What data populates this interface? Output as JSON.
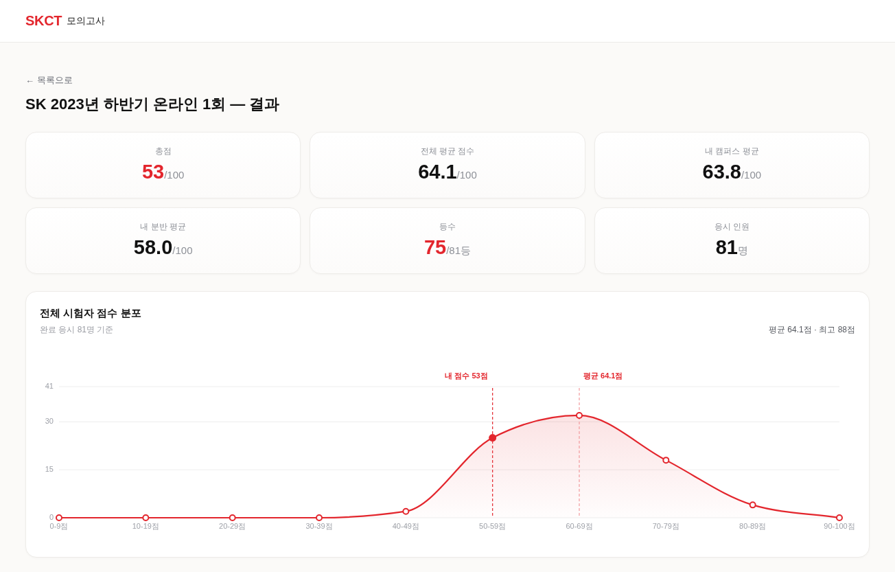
{
  "header": {
    "logo": "SKCT",
    "title": "모의고사"
  },
  "back_link": "← 목록으로",
  "page_title": "SK 2023년 하반기 온라인 1회 — 결과",
  "stats": [
    {
      "label": "총점",
      "value": "53",
      "unit": "/100",
      "highlight": true
    },
    {
      "label": "전체 평균 점수",
      "value": "64.1",
      "unit": "/100",
      "highlight": false
    },
    {
      "label": "내 캠퍼스 평균",
      "value": "63.8",
      "unit": "/100",
      "highlight": false
    },
    {
      "label": "내 분반 평균",
      "value": "58.0",
      "unit": "/100",
      "highlight": false
    },
    {
      "label": "등수",
      "value": "75",
      "unit": "/81등",
      "highlight": true
    },
    {
      "label": "응시 인원",
      "value": "81",
      "unit": "명",
      "highlight": false
    }
  ],
  "distribution": {
    "title": "전체 시험자 점수 분포",
    "subtitle": "완료 응시 81명 기준",
    "summary": "평균 64.1점 · 최고 88점",
    "chart_data": {
      "type": "area",
      "categories": [
        "0-9점",
        "10-19점",
        "20-29점",
        "30-39점",
        "40-49점",
        "50-59점",
        "60-69점",
        "70-79점",
        "80-89점",
        "90-100점"
      ],
      "series": [
        {
          "color": "#e3262d",
          "values": [
            0,
            0,
            0,
            0,
            2,
            25,
            32,
            18,
            4,
            0
          ]
        }
      ],
      "ylim": [
        0,
        41
      ],
      "yticks": [
        0,
        15,
        30,
        41
      ],
      "ref_lines": [
        {
          "axis": "x",
          "value": "50-59점",
          "label": "내 점수 53점",
          "color": "#e3262d"
        },
        {
          "axis": "x",
          "value": "60-69점",
          "label": "평균 64.1점",
          "color": "#f29a9d"
        }
      ]
    }
  }
}
